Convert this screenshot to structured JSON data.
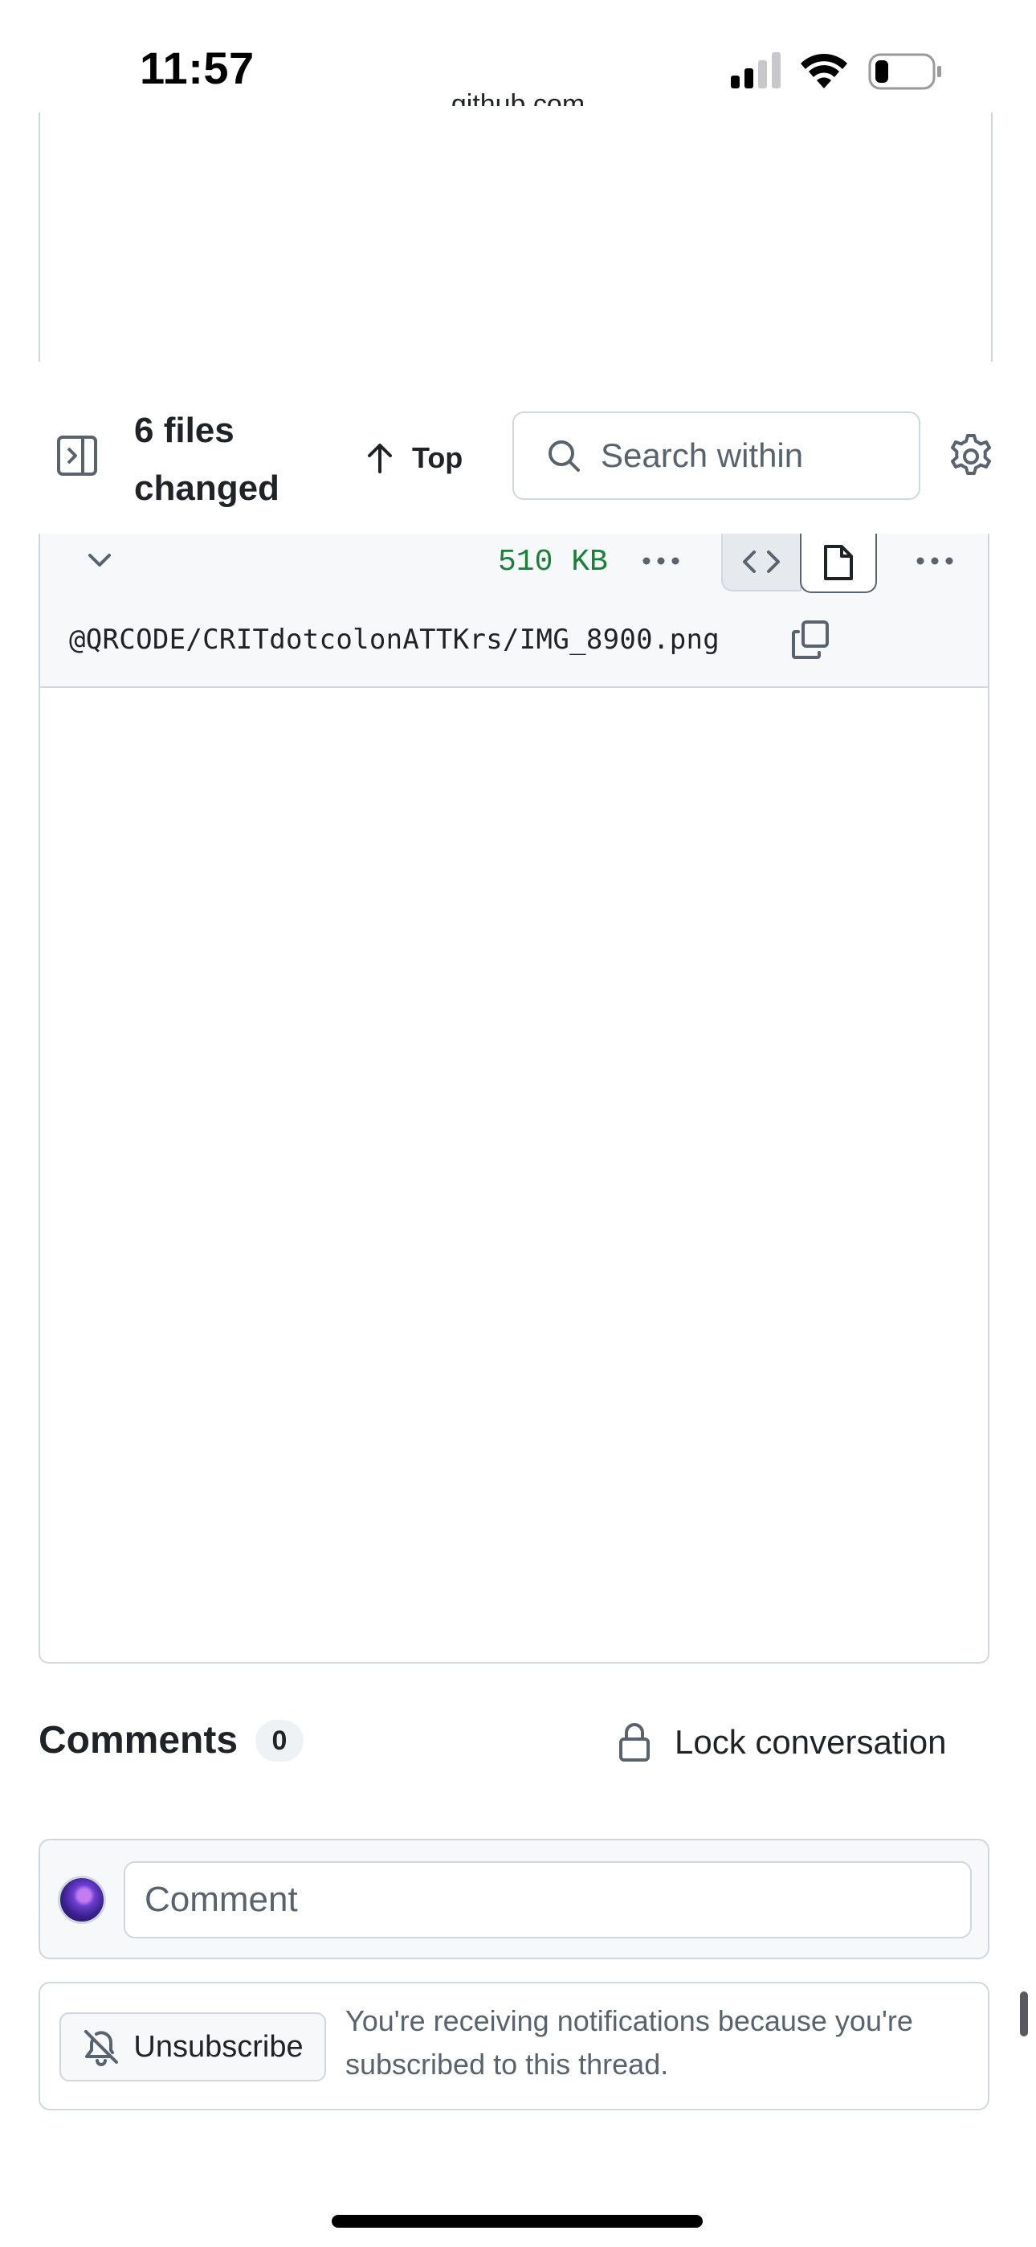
{
  "status_bar": {
    "time": "11:57"
  },
  "previous_file": {
    "domain_text": "github.com"
  },
  "toolbar": {
    "files_changed": "6 files changed",
    "top_label": "Top",
    "search_placeholder": "Search within code"
  },
  "file": {
    "size": "510 KB",
    "path": "@QRCODE/CRITdotcolonATTKrs/IMG_8900.png"
  },
  "comments": {
    "title": "Comments",
    "count": "0",
    "lock_label": "Lock conversation",
    "input_placeholder": "Comment"
  },
  "notifications": {
    "button_label": "Unsubscribe",
    "text": "You're receiving notifications because you're subscribed to this thread."
  },
  "colors": {
    "border": "#d0d7de",
    "muted_text": "#59636e",
    "size_green": "#1a7f37",
    "header_bg": "#f6f8fa"
  }
}
